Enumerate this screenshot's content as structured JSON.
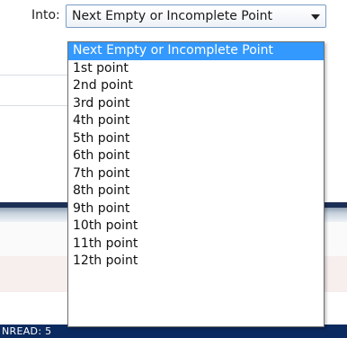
{
  "into": {
    "label": "Into:",
    "selected_value": "Next Empty or Incomplete Point"
  },
  "dropdown": {
    "options": [
      "Next Empty or Incomplete Point",
      "1st point",
      "2nd point",
      "3rd point",
      "4th point",
      "5th point",
      "6th point",
      "7th point",
      "8th point",
      "9th point",
      "10th point",
      "11th point",
      "12th point"
    ],
    "highlighted_index": 0,
    "highlight_color": "#3399ff"
  },
  "status_bar": {
    "text": "NREAD: 5"
  },
  "icons": {
    "combo_arrow": "chevron-down-icon"
  }
}
